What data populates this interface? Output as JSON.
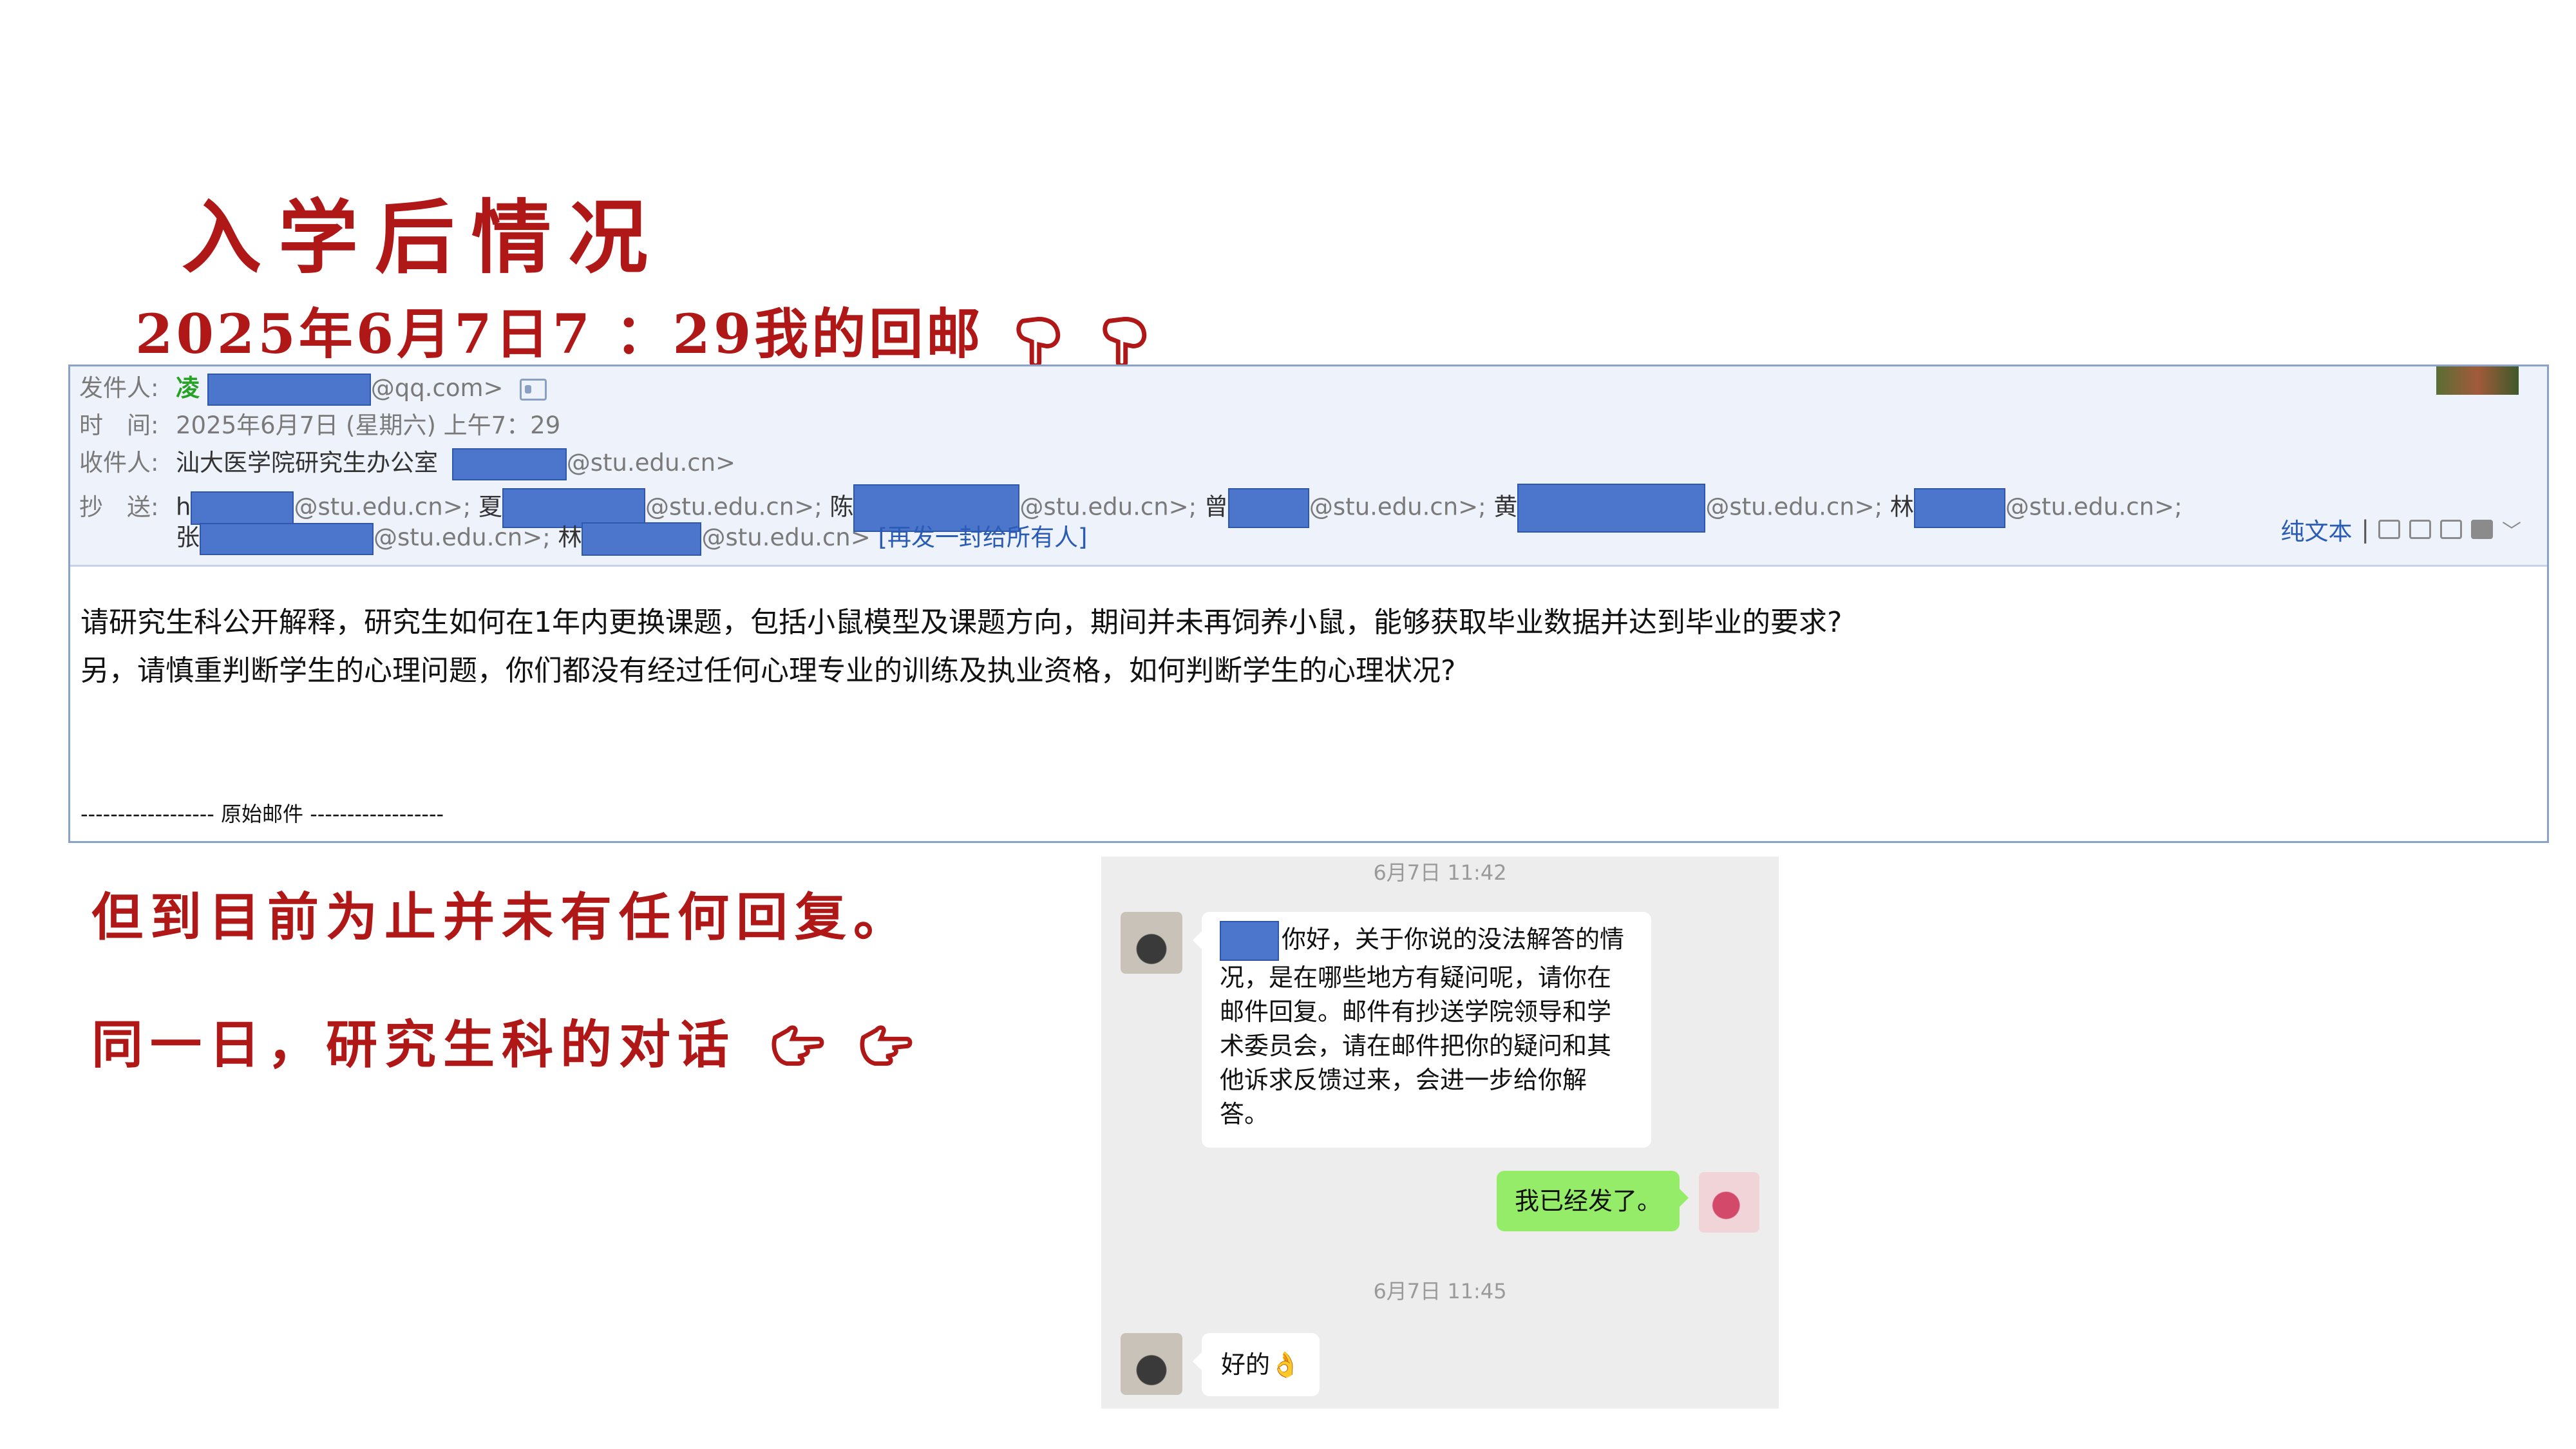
{
  "slide": {
    "title": "入学后情况",
    "subtitle": "2025年6月7日7 ：29我的回邮",
    "no_reply_note": "但到目前为止并未有任何回复。",
    "same_day_note": "同一日，研究生科的对话"
  },
  "email": {
    "from_label": "发件人:",
    "from_name": "凌",
    "from_domain": "@qq.com>",
    "time_label": "时　间:",
    "time_value": "2025年6月7日 (星期六) 上午7：29",
    "to_label": "收件人:",
    "to_name": "汕大医学院研究生办公室",
    "to_domain": "@stu.edu.cn>",
    "cc_label": "抄　送:",
    "cc_line1": [
      {
        "prefix": "h",
        "domain": "@stu.edu.cn>;"
      },
      {
        "prefix": "夏",
        "domain": "@stu.edu.cn>;"
      },
      {
        "prefix": "陈",
        "domain": "@stu.edu.cn>;"
      },
      {
        "prefix": "曾",
        "domain": "@stu.edu.cn>;"
      },
      {
        "prefix": "黄",
        "domain": "@stu.edu.cn>;"
      },
      {
        "prefix": "林",
        "domain": "@stu.edu.cn>;"
      }
    ],
    "cc_line2": [
      {
        "prefix": "张",
        "domain": "@stu.edu.cn>;"
      },
      {
        "prefix": "林",
        "domain": "@stu.edu.cn>"
      }
    ],
    "reply_all": "[再发一封给所有人]",
    "toolbar": {
      "plain_text": "纯文本",
      "separator": "|"
    },
    "body_line1": "请研究生科公开解释，研究生如何在1年内更换课题，包括小鼠模型及课题方向，期间并未再饲养小鼠，能够获取毕业数据并达到毕业的要求?",
    "body_line2": "另，请慎重判断学生的心理问题，你们都没有经过任何心理专业的训练及执业资格，如何判断学生的心理状况?",
    "original_divider": "------------------ 原始邮件 ------------------"
  },
  "chat": {
    "time1": "6月7日 11:42",
    "msg1": "你好，关于你说的没法解答的情况，是在哪些地方有疑问呢，请你在邮件回复。邮件有抄送学院领导和学术委员会，请在邮件把你的疑问和其他诉求反馈过来，会进一步给你解答。",
    "msg2": "我已经发了。",
    "time2": "6月7日 11:45",
    "msg3": "好的👌"
  }
}
